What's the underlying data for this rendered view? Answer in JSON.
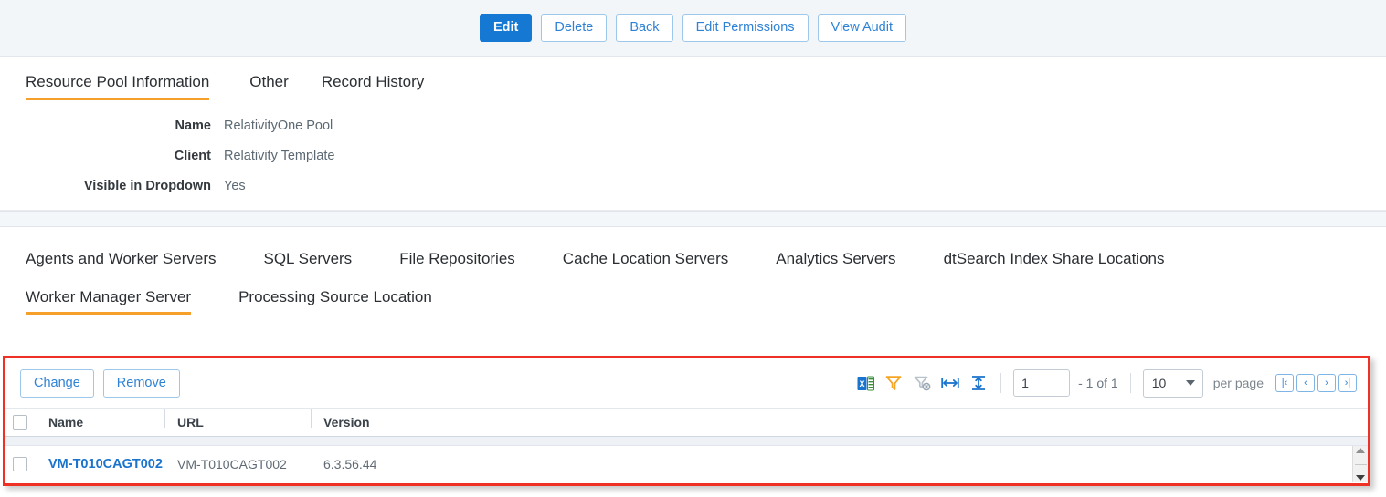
{
  "command_bar": {
    "buttons": [
      {
        "label": "Edit",
        "style": "primary",
        "name": "edit-button"
      },
      {
        "label": "Delete",
        "style": "secondary",
        "name": "delete-button"
      },
      {
        "label": "Back",
        "style": "secondary",
        "name": "back-button"
      },
      {
        "label": "Edit Permissions",
        "style": "secondary",
        "name": "edit-permissions-button"
      },
      {
        "label": "View Audit",
        "style": "secondary",
        "name": "view-audit-button"
      }
    ]
  },
  "primary_tabs": {
    "items": [
      {
        "label": "Resource Pool Information",
        "active": true
      },
      {
        "label": "Other",
        "active": false
      },
      {
        "label": "Record History",
        "active": false
      }
    ],
    "active_underline_color": "#f6a02b"
  },
  "info_panel": {
    "fields": [
      {
        "label": "Name",
        "value": "RelativityOne Pool"
      },
      {
        "label": "Client",
        "value": "Relativity Template"
      },
      {
        "label": "Visible in Dropdown",
        "value": "Yes"
      }
    ]
  },
  "secondary_tabs": {
    "row1": [
      {
        "label": "Agents and Worker Servers",
        "active": false
      },
      {
        "label": "SQL Servers",
        "active": false
      },
      {
        "label": "File Repositories",
        "active": false
      },
      {
        "label": "Cache Location Servers",
        "active": false
      },
      {
        "label": "Analytics Servers",
        "active": false
      },
      {
        "label": "dtSearch Index Share Locations",
        "active": false
      }
    ],
    "row2": [
      {
        "label": "Worker Manager Server",
        "active": true
      },
      {
        "label": "Processing Source Location",
        "active": false
      }
    ]
  },
  "grid_toolbar": {
    "change_label": "Change",
    "remove_label": "Remove",
    "icons": [
      {
        "name": "export-to-excel-icon"
      },
      {
        "name": "filter-icon"
      },
      {
        "name": "clear-filter-icon"
      },
      {
        "name": "fit-columns-icon"
      },
      {
        "name": "row-height-icon"
      }
    ],
    "page_number": "1",
    "page_range": "- 1 of 1",
    "per_page_value": "10",
    "per_page_label": "per page",
    "pager": [
      {
        "glyph": "|‹",
        "name": "first-page-button"
      },
      {
        "glyph": "‹",
        "name": "previous-page-button"
      },
      {
        "glyph": "›",
        "name": "next-page-button"
      },
      {
        "glyph": "›|",
        "name": "last-page-button"
      }
    ]
  },
  "grid": {
    "columns": [
      "Name",
      "URL",
      "Version"
    ],
    "rows": [
      {
        "name": "VM-T010CAGT002",
        "url": "VM-T010CAGT002",
        "version": "6.3.56.44"
      }
    ]
  },
  "highlight": {
    "color": "#ee3124"
  }
}
